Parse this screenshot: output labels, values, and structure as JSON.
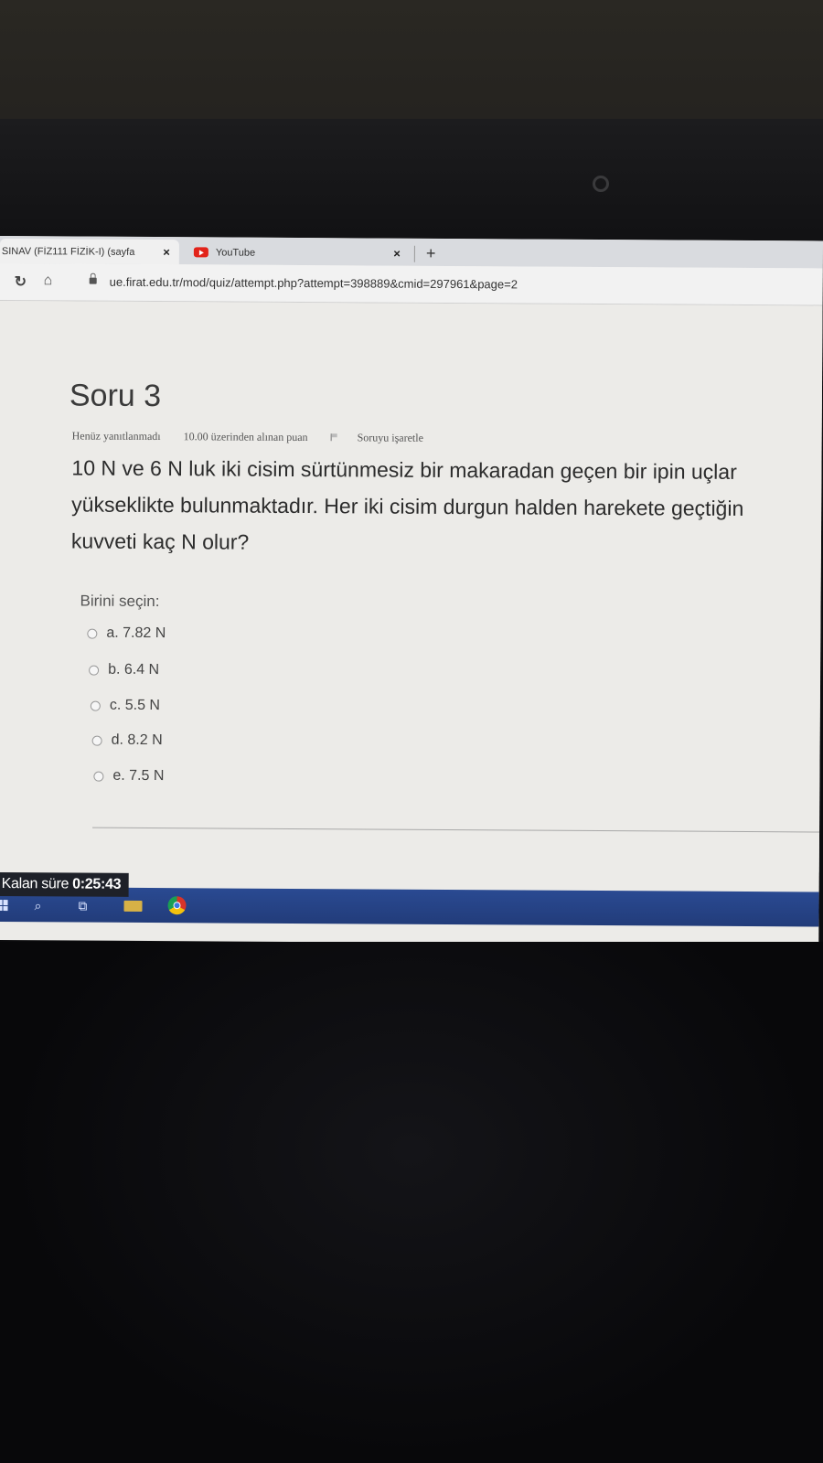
{
  "browser": {
    "tabs": [
      {
        "label": "SINAV (FİZ111 FİZİK-I) (sayfa",
        "close": "×"
      },
      {
        "label": "YouTube",
        "close": "×"
      }
    ],
    "new_tab": "+",
    "url": "ue.firat.edu.tr/mod/quiz/attempt.php?attempt=398889&cmid=297961&page=2"
  },
  "question": {
    "title": "Soru 3",
    "status": "Henüz yanıtlanmadı",
    "points": "10.00 üzerinden alınan puan",
    "flag_label": "Soruyu işaretle",
    "text_lines": [
      "10 N ve 6 N luk iki cisim sürtünmesiz bir makaradan geçen bir ipin uçlar",
      "yükseklikte bulunmaktadır. Her iki cisim durgun halden harekete geçtiğin",
      "kuvveti kaç N olur?"
    ],
    "prompt": "Birini seçin:",
    "options": [
      "a. 7.82 N",
      "b. 6.4 N",
      "c. 5.5 N",
      "d. 8.2 N",
      "e. 7.5 N"
    ]
  },
  "timer": {
    "label": "Kalan süre",
    "value": "0:25:43"
  }
}
